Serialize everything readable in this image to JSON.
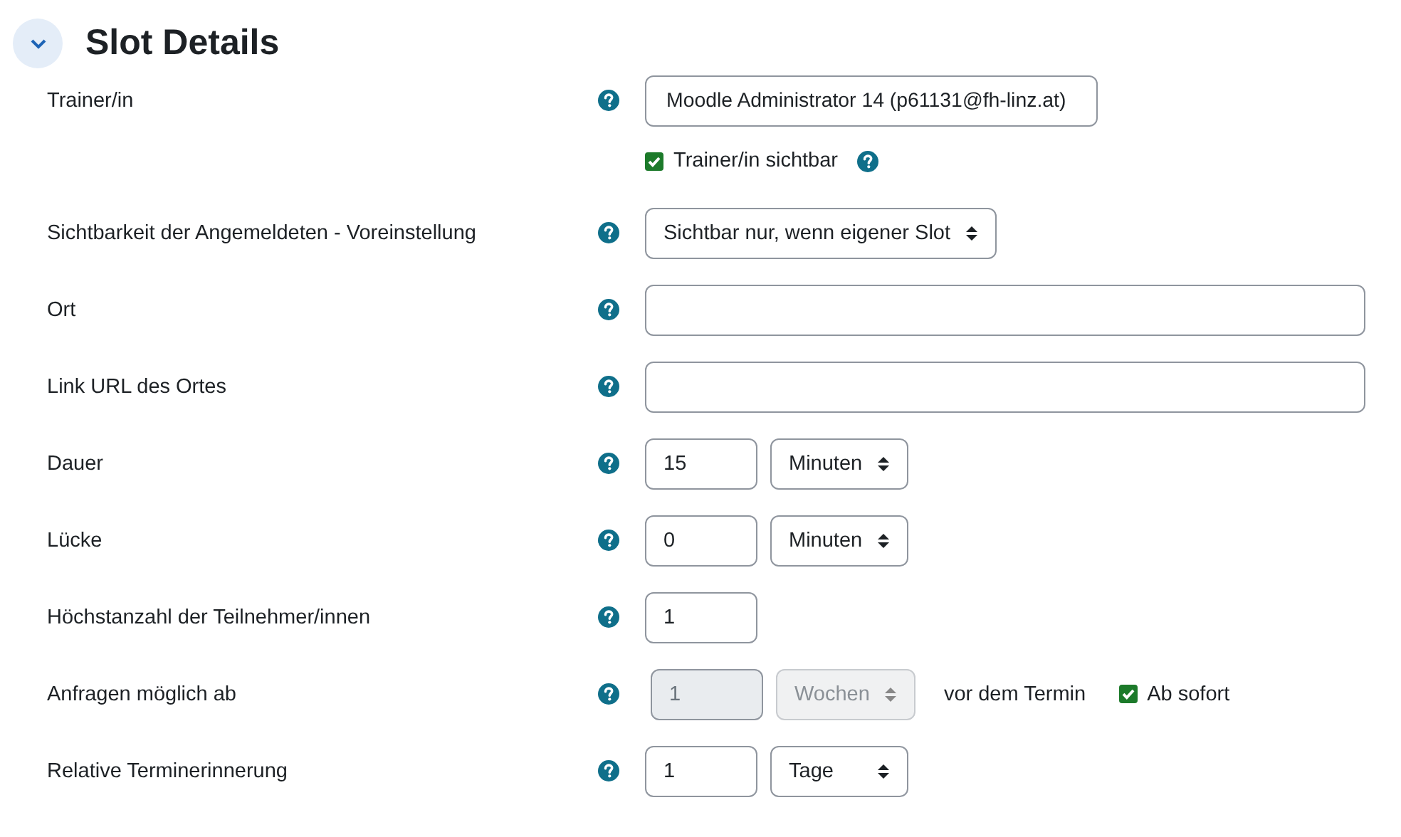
{
  "section": {
    "title": "Slot Details",
    "expanded": true
  },
  "rows": [
    {
      "label": "Trainer/in",
      "help": true,
      "controls": [
        {
          "kind": "medium_text",
          "value": "Moodle Administrator 14 (p61131@fh-linz.at)",
          "disabled": false
        }
      ]
    },
    {
      "controls": [
        {
          "kind": "checkbox",
          "label": "Trainer/in sichtbar",
          "checked": true,
          "help": true
        }
      ]
    },
    {
      "label": "Sichtbarkeit der Angemeldeten - Voreinstellung",
      "help": true,
      "controls": [
        {
          "kind": "select",
          "value": "Sichtbar nur, wenn eigener Slot",
          "disabled": false
        }
      ]
    },
    {
      "label": "Ort",
      "help": true,
      "controls": [
        {
          "kind": "long_text",
          "disabled": false
        }
      ]
    },
    {
      "label": "Link URL des Ortes",
      "help": true,
      "controls": [
        {
          "kind": "long_text",
          "disabled": false
        }
      ]
    },
    {
      "label": "Dauer",
      "help": true,
      "controls": [
        {
          "kind": "text",
          "value": "15",
          "disabled": false
        },
        {
          "kind": "select",
          "value": "Minuten",
          "disabled": false
        }
      ]
    },
    {
      "label": "Lücke",
      "help": true,
      "controls": [
        {
          "kind": "text",
          "value": "0",
          "disabled": false
        },
        {
          "kind": "select",
          "value": "Minuten",
          "disabled": false
        }
      ]
    },
    {
      "label": "Höchstanzahl der Teilnehmer/innen",
      "help": true,
      "controls": [
        {
          "kind": "text",
          "value": "1",
          "disabled": false
        }
      ]
    },
    {
      "label": "Anfragen möglich ab",
      "help": true,
      "controls": [
        {
          "kind": "text",
          "value": "1",
          "disabled": true
        },
        {
          "kind": "select",
          "value": "Wochen",
          "disabled": true
        },
        {
          "kind": "static",
          "text": "vor dem Termin"
        },
        {
          "kind": "checkbox",
          "label": "Ab sofort",
          "checked": true
        }
      ]
    },
    {
      "label": "Relative Terminerinnerung",
      "help": true,
      "controls": [
        {
          "kind": "text",
          "value": "1",
          "disabled": false
        },
        {
          "kind": "select",
          "value": "Tage",
          "disabled": false
        }
      ]
    }
  ]
}
